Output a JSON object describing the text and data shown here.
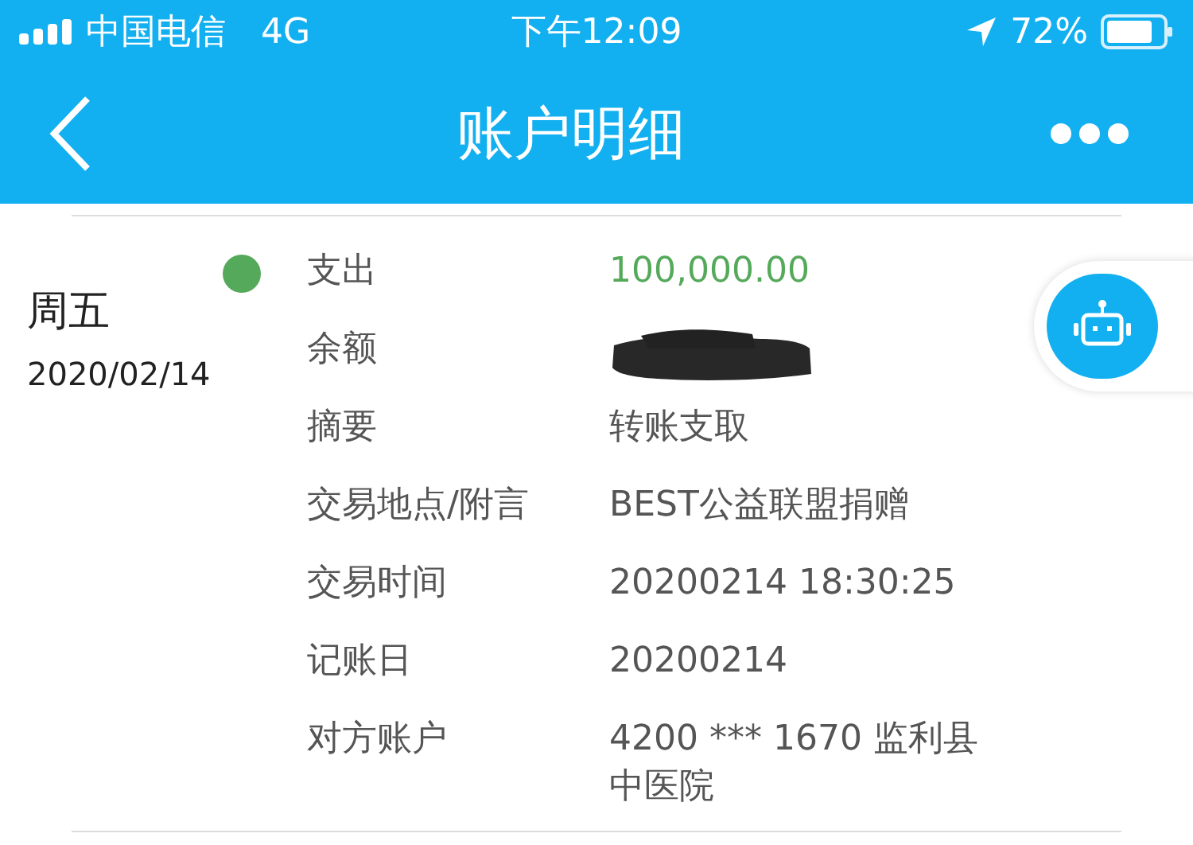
{
  "status_bar": {
    "carrier": "中国电信",
    "network": "4G",
    "time": "下午12:09",
    "battery": "72%"
  },
  "nav": {
    "title": "账户明细"
  },
  "transaction": {
    "weekday": "周五",
    "date": "2020/02/14",
    "color": "#55a95a",
    "rows": [
      {
        "label": "支出",
        "kind": "text",
        "value": "100,000.00",
        "color": "#55a95a"
      },
      {
        "label": "余额",
        "kind": "redacted"
      },
      {
        "label": "摘要",
        "kind": "text",
        "value": "转账支取"
      },
      {
        "label": "交易地点/附言",
        "kind": "text",
        "value": "BEST公益联盟捐赠"
      },
      {
        "label": "交易时间",
        "kind": "text",
        "value": "20200214 18:30:25"
      },
      {
        "label": "记账日",
        "kind": "text",
        "value": "20200214"
      },
      {
        "label": "对方账户",
        "kind": "text",
        "value": "4200 *** 1670 监利县中医院"
      }
    ]
  }
}
